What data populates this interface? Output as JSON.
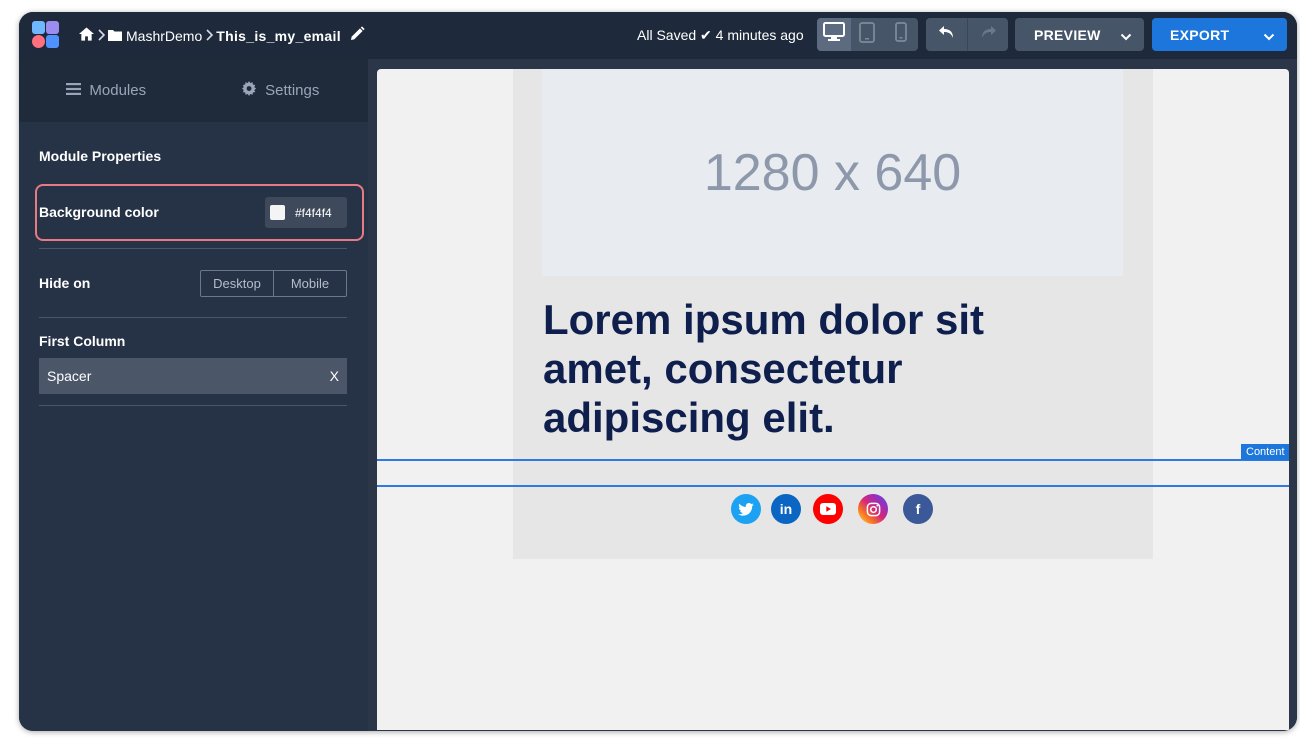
{
  "header": {
    "breadcrumb": {
      "home_icon": "home-icon",
      "folder_icon": "folder-icon",
      "folder": "MashrDemo",
      "document": "This_is_my_email",
      "edit_icon": "pencil-icon"
    },
    "save_status": "All Saved ✔ 4 minutes ago",
    "device_buttons": [
      {
        "icon": "desktop-icon",
        "active": true
      },
      {
        "icon": "tablet-icon",
        "active": false
      },
      {
        "icon": "mobile-icon",
        "active": false
      }
    ],
    "undo_icon": "undo-icon",
    "redo_icon": "redo-icon",
    "preview_label": "PREVIEW",
    "export_label": "EXPORT"
  },
  "sidebar": {
    "tabs": [
      {
        "label": "Modules",
        "icon": "menu-icon"
      },
      {
        "label": "Settings",
        "icon": "gear-icon"
      }
    ],
    "section_title": "Module Properties",
    "background_color": {
      "label": "Background color",
      "value": "#f4f4f4"
    },
    "hide_on": {
      "label": "Hide on",
      "options": [
        "Desktop",
        "Mobile"
      ]
    },
    "first_column": {
      "label": "First Column",
      "item": "Spacer",
      "remove": "X"
    }
  },
  "canvas": {
    "image_placeholder": "1280 x 640",
    "headline": "Lorem ipsum dolor sit amet, consectetur adipiscing elit.",
    "selection_tag": "Content",
    "socials": [
      {
        "name": "twitter",
        "icon": "twitter-icon",
        "color": "#1da1f2"
      },
      {
        "name": "linkedin",
        "icon": "linkedin-icon",
        "color": "#0a66c2",
        "glyph": "in"
      },
      {
        "name": "youtube",
        "icon": "youtube-icon",
        "color": "#ff0000"
      },
      {
        "name": "instagram",
        "icon": "instagram-icon",
        "color": "#d62976"
      },
      {
        "name": "facebook",
        "icon": "facebook-icon",
        "color": "#3b5998",
        "glyph": "f"
      }
    ]
  },
  "colors": {
    "topbar": "#1e2a3b",
    "sidebar": "#263246",
    "accent": "#1d76db",
    "highlight_border": "#e97a83",
    "headline": "#0e1e4d"
  }
}
